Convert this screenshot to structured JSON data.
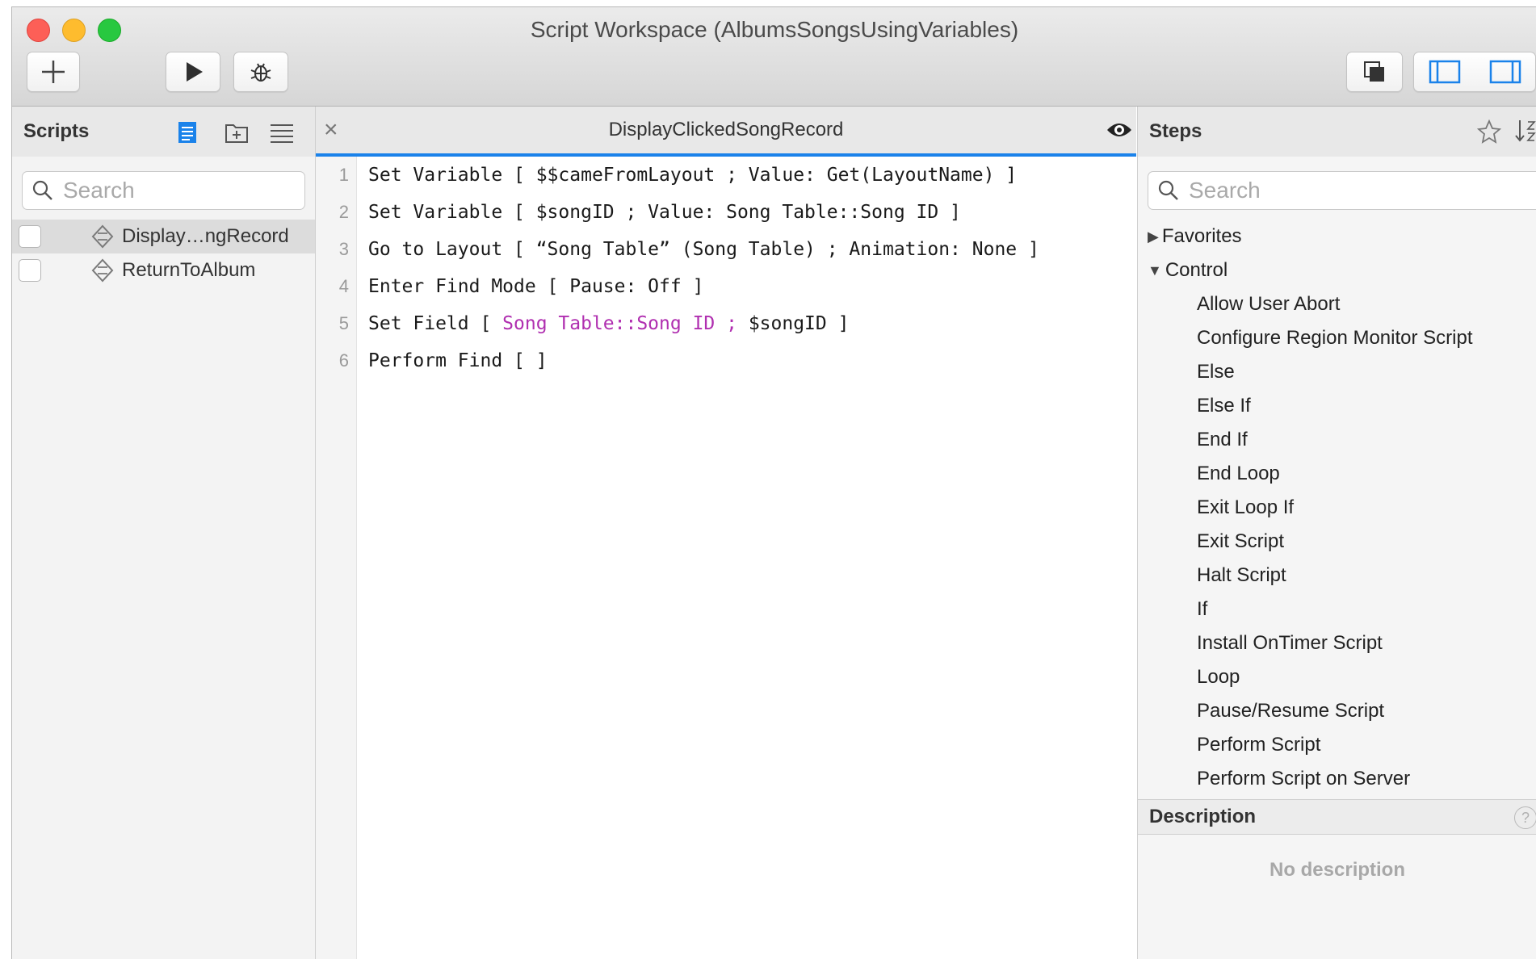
{
  "window": {
    "title": "Script Workspace (AlbumsSongsUsingVariables)"
  },
  "toolbar": {
    "new_icon": "plus-icon",
    "run_icon": "play-icon",
    "debug_icon": "bug-icon",
    "right_icons": [
      "stack-icon",
      "left-sidebar-icon",
      "right-sidebar-icon"
    ]
  },
  "scripts": {
    "title": "Scripts",
    "search_placeholder": "Search",
    "items": [
      {
        "label": "Display…ngRecord",
        "selected": true,
        "checked": false
      },
      {
        "label": "ReturnToAlbum",
        "selected": false,
        "checked": false
      }
    ]
  },
  "editor": {
    "tab_title": "DisplayClickedSongRecord",
    "close_symbol": "×",
    "lines": [
      {
        "n": "1",
        "pre": "Set Variable [ $$cameFromLayout ; Value: Get(LayoutName) ]",
        "hl": "",
        "post": ""
      },
      {
        "n": "2",
        "pre": "Set Variable [ $songID ; Value: Song Table::Song ID ]",
        "hl": "",
        "post": ""
      },
      {
        "n": "3",
        "pre": "Go to Layout [ “Song Table” (Song Table) ; Animation: None ]",
        "hl": "",
        "post": ""
      },
      {
        "n": "4",
        "pre": "Enter Find Mode [ Pause: Off ]",
        "hl": "",
        "post": ""
      },
      {
        "n": "5",
        "pre": "Set Field [ ",
        "hl": "Song Table::Song ID ;",
        "post": " $songID ]"
      },
      {
        "n": "6",
        "pre": "Perform Find [ ]",
        "hl": "",
        "post": ""
      }
    ]
  },
  "steps": {
    "title": "Steps",
    "search_placeholder": "Search",
    "categories": [
      {
        "label": "Favorites",
        "expanded": false
      },
      {
        "label": "Control",
        "expanded": true
      }
    ],
    "control_items": [
      "Allow User Abort",
      "Configure Region Monitor Script",
      "Else",
      "Else If",
      "End If",
      "End Loop",
      "Exit Loop If",
      "Exit Script",
      "Halt Script",
      "If",
      "Install OnTimer Script",
      "Loop",
      "Pause/Resume Script",
      "Perform Script",
      "Perform Script on Server"
    ]
  },
  "description": {
    "title": "Description",
    "empty_text": "No description",
    "help_symbol": "?"
  },
  "colors": {
    "accent": "#1a82ea",
    "highlight_purple": "#b02fb0"
  }
}
